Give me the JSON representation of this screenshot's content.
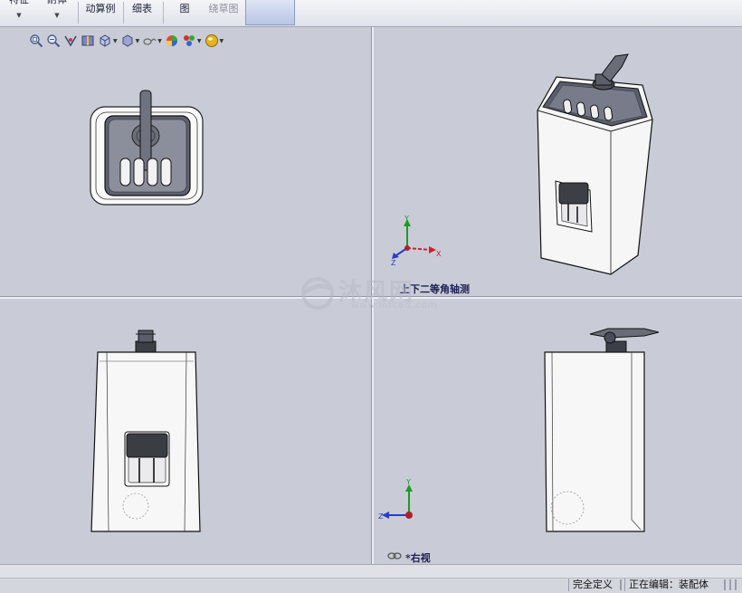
{
  "ribbon": {
    "items": [
      {
        "label": "特征",
        "dropdown": true
      },
      {
        "label": "耐体",
        "dropdown": true
      },
      {
        "label": "动算例"
      },
      {
        "label": "细表"
      },
      {
        "label": "图"
      },
      {
        "label": "绕草图",
        "disabled": true
      }
    ]
  },
  "heads_up_toolbar": {
    "icons": [
      "zoom-to-fit-icon",
      "zoom-area-icon",
      "previous-view-icon",
      "section-view-icon",
      "view-orientation-icon",
      "display-style-icon",
      "hide-show-items-icon",
      "edit-appearance-icon",
      "apply-scene-icon",
      "view-settings-icon"
    ]
  },
  "viewports": {
    "top_left": {
      "label": ""
    },
    "top_right": {
      "label": "上下二等角轴测"
    },
    "bottom_left": {
      "label": ""
    },
    "bottom_right": {
      "label": "*右视"
    }
  },
  "triad": {
    "x": "X",
    "y": "Y",
    "z": "Z"
  },
  "watermark": {
    "text": "沐风网",
    "url": "www.mfcad.com"
  },
  "status_bar": {
    "fully_defined": "完全定义",
    "editing": "正在编辑：装配体"
  },
  "colors": {
    "background": "#c9ccd6",
    "model_body": "#f4f4f4",
    "model_dark": "#4e5059",
    "axis_x": "#d0202a",
    "axis_y": "#1d9a24",
    "axis_z": "#2a3cc8"
  }
}
